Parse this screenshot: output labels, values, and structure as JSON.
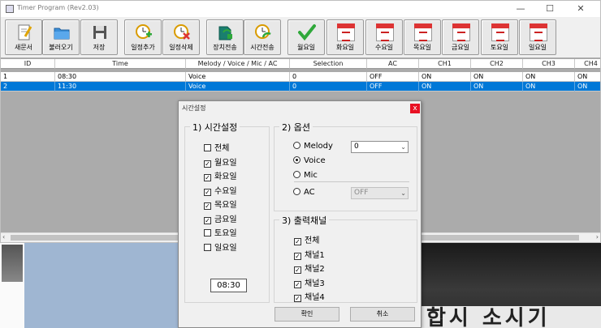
{
  "app": {
    "title": "Timer Program (Rev2.03)"
  },
  "window_controls": {
    "minimize": "—",
    "maximize": "☐",
    "close": "✕"
  },
  "toolbar": {
    "buttons": [
      {
        "label": "새문서",
        "icon": "new-document-icon"
      },
      {
        "label": "불러오기",
        "icon": "open-folder-icon"
      },
      {
        "label": "저장",
        "icon": "save-disk-icon"
      },
      {
        "label": "일정추가",
        "icon": "add-schedule-icon"
      },
      {
        "label": "일정삭제",
        "icon": "delete-schedule-icon"
      },
      {
        "label": "장치전송",
        "icon": "device-send-icon"
      },
      {
        "label": "시간전송",
        "icon": "time-send-icon"
      },
      {
        "label": "월요일",
        "icon": "check-icon"
      },
      {
        "label": "화요일",
        "icon": "calendar-icon"
      },
      {
        "label": "수요일",
        "icon": "calendar-icon"
      },
      {
        "label": "목요일",
        "icon": "calendar-icon"
      },
      {
        "label": "금요일",
        "icon": "calendar-icon"
      },
      {
        "label": "토요일",
        "icon": "calendar-icon"
      },
      {
        "label": "일요일",
        "icon": "calendar-icon"
      }
    ]
  },
  "grid": {
    "columns": [
      "ID",
      "Time",
      "Melody / Voice / Mic / AC",
      "Selection",
      "AC",
      "CH1",
      "CH2",
      "CH3",
      "CH4"
    ],
    "rows": [
      [
        "1",
        "08:30",
        "Voice",
        "0",
        "OFF",
        "ON",
        "ON",
        "ON",
        "ON"
      ],
      [
        "2",
        "11:30",
        "Voice",
        "0",
        "OFF",
        "ON",
        "ON",
        "ON",
        "ON"
      ]
    ],
    "selected_row": 2
  },
  "dialog": {
    "title": "시간설정",
    "close_label": "x",
    "time_group": {
      "title": "1) 시간설정",
      "days": [
        {
          "label": "전체",
          "checked": false
        },
        {
          "label": "월요일",
          "checked": true
        },
        {
          "label": "화요일",
          "checked": true
        },
        {
          "label": "수요일",
          "checked": true
        },
        {
          "label": "목요일",
          "checked": true
        },
        {
          "label": "금요일",
          "checked": true
        },
        {
          "label": "토요일",
          "checked": false
        },
        {
          "label": "일요일",
          "checked": false
        }
      ],
      "time_value": "08:30"
    },
    "options_group": {
      "title": "2) 옵션",
      "options": [
        {
          "label": "Melody",
          "selected": false
        },
        {
          "label": "Voice",
          "selected": true
        },
        {
          "label": "Mic",
          "selected": false
        },
        {
          "label": "AC",
          "selected": false
        }
      ],
      "melody_value": "0",
      "ac_value": "OFF"
    },
    "channels_group": {
      "title": "3) 출력채널",
      "channels": [
        {
          "label": "전체",
          "checked": true
        },
        {
          "label": "채널1",
          "checked": true
        },
        {
          "label": "채널2",
          "checked": true
        },
        {
          "label": "채널3",
          "checked": true
        },
        {
          "label": "채널4",
          "checked": true
        }
      ]
    },
    "ok_label": "확인",
    "cancel_label": "취소"
  },
  "background": {
    "text": "합시 소시기"
  },
  "colors": {
    "selection": "#0078d7",
    "close": "#e81123",
    "accent_red": "#d33333",
    "check_green": "#2fa83a"
  },
  "marks": {
    "check": "✓",
    "arrow_down": "⌄",
    "scroll_left": "‹",
    "scroll_right": "›"
  }
}
